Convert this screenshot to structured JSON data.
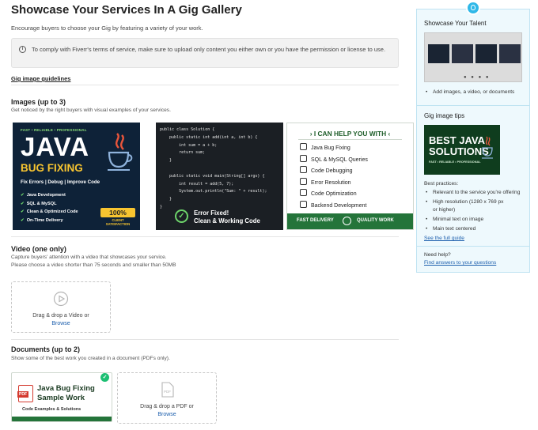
{
  "header": {
    "title": "Showcase Your Services In A Gig Gallery",
    "subtitle": "Encourage buyers to choose your Gig by featuring a variety of your work."
  },
  "notice": {
    "icon": "info-icon",
    "text": "To comply with Fiverr's terms of service, make sure to upload only content you either own or you have the permission or license to use."
  },
  "guidelines_link": "Gig image guidelines",
  "images": {
    "title": "Images (up to 3)",
    "subtitle": "Get noticed by the right buyers with visual examples of your services.",
    "card1": {
      "tagline": "FAST • RELIABLE • PROFESSIONAL",
      "title": "JAVA",
      "subtitle": "BUG FIXING",
      "line": "Fix Errors | Debug | Improve Code",
      "bullets": [
        "Java Development",
        "SQL & MySQL",
        "Clean & Optimized Code",
        "On-Time Delivery"
      ],
      "badge_value": "100%",
      "badge_label": "CLIENT SATISFACTION"
    },
    "card2": {
      "code": [
        "public class Solution {",
        "    public static int add(int a, int b) {",
        "        int sum = a + b;",
        "        return sum;",
        "    }",
        "",
        "    public static void main(String[] args) {",
        "        int result = add(5, 7);",
        "        System.out.println(\"Sum: \" + result);",
        "    }",
        "}"
      ],
      "caption_line1": "Error Fixed!",
      "caption_line2": "Clean & Working Code"
    },
    "card3": {
      "heading": "I CAN HELP YOU WITH",
      "items": [
        "Java Bug Fixing",
        "SQL & MySQL Queries",
        "Code Debugging",
        "Error Resolution",
        "Code Optimization",
        "Backend Development"
      ],
      "footer_left": "FAST DELIVERY",
      "footer_right": "QUALITY WORK"
    }
  },
  "video": {
    "title": "Video (one only)",
    "subtitle_line1": "Capture buyers' attention with a video that showcases your service.",
    "subtitle_line2": "Please choose a video shorter than 75 seconds and smaller than 50MB",
    "drop_text": "Drag & drop a Video or",
    "browse": "Browse"
  },
  "documents": {
    "title": "Documents (up to 2)",
    "subtitle": "Show some of the best work you created in a document (PDFs only).",
    "doc_card": {
      "pdf_label": "PDF",
      "title_line1": "Java Bug Fixing",
      "title_line2": "Sample Work",
      "subtitle": "Code Examples & Solutions"
    },
    "drop_text": "Drag & drop a PDF or",
    "browse": "Browse"
  },
  "sidebar": {
    "section1_title": "Showcase Your Talent",
    "section1_bullet": "Add images, a video, or documents",
    "section2_title": "Gig image tips",
    "thumb_line1": "BEST JAVA",
    "thumb_line2": "SOLUTIONS",
    "thumb_tagline": "FAST • RELIABLE • PROFESSIONAL",
    "best_practices_label": "Best practices:",
    "best_practices": [
      "Relevant to the service you're offering",
      "High resolution (1280 x 769 px",
      "or higher)",
      "Minimal text on image",
      "Main text centered"
    ],
    "guide_link": "See the full guide",
    "help_label": "Need help?",
    "help_link": "Find answers to your questions"
  },
  "colors": {
    "accent_green": "#1dbf73",
    "dark_green": "#24743a",
    "link_blue": "#1d5fad",
    "sidebar_bg": "#eef9fd"
  }
}
